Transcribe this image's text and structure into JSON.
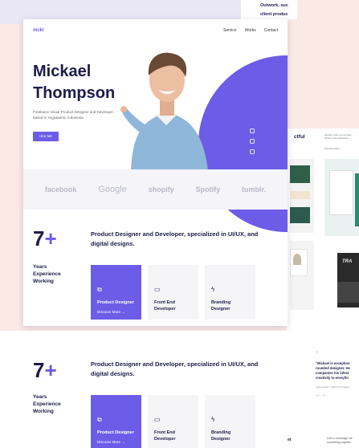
{
  "top_card": {
    "line1": "Outwork, suc",
    "line2": "client produc"
  },
  "nav": {
    "logo": "mckl",
    "items": [
      "Service",
      "Works",
      "Contact"
    ]
  },
  "hero": {
    "name_line1": "Mickael",
    "name_line2": "Thompson",
    "description": "Freelance Visual Product Designer and Developer based in Yogyakarta, Indonesia.",
    "hire_label": "Hire Me"
  },
  "socials": [
    "instagram-icon",
    "dribbble-icon",
    "linkedin-icon"
  ],
  "brands": [
    "facebook",
    "Google",
    "shopify",
    "Spotify",
    "tumblr."
  ],
  "experience": {
    "number": "7",
    "plus": "+",
    "label_line1": "Years",
    "label_line2": "Experience",
    "label_line3": "Working",
    "headline": "Product Designer and Developer, specialized in UI/UX, and digital designs.",
    "services": [
      {
        "icon": "layers-icon",
        "title_line1": "Product Designer",
        "title_line2": "",
        "more": "Discover More"
      },
      {
        "icon": "monitor-icon",
        "title_line1": "Front End",
        "title_line2": "Developer",
        "more": ""
      },
      {
        "icon": "bolt-icon",
        "title_line1": "Branding",
        "title_line2": "Designer",
        "more": ""
      }
    ]
  },
  "right_preview": {
    "title": "ctful",
    "desc": "Sitoplex nulla, sed eti integ labituco porta aliquamet.",
    "link": "Discover More  →",
    "quote": "\"Mickael is exception rounded designer. He companies his infect creativity to everythi",
    "author": "Arlene Peter - CEO of Company",
    "arrows": "←  →",
    "cta_title": "et",
    "cta_text": "Let's c message me something togethe"
  },
  "colors": {
    "accent": "#6c5ce7",
    "navy": "#1c1c4a",
    "background": "#fbe9e6"
  }
}
